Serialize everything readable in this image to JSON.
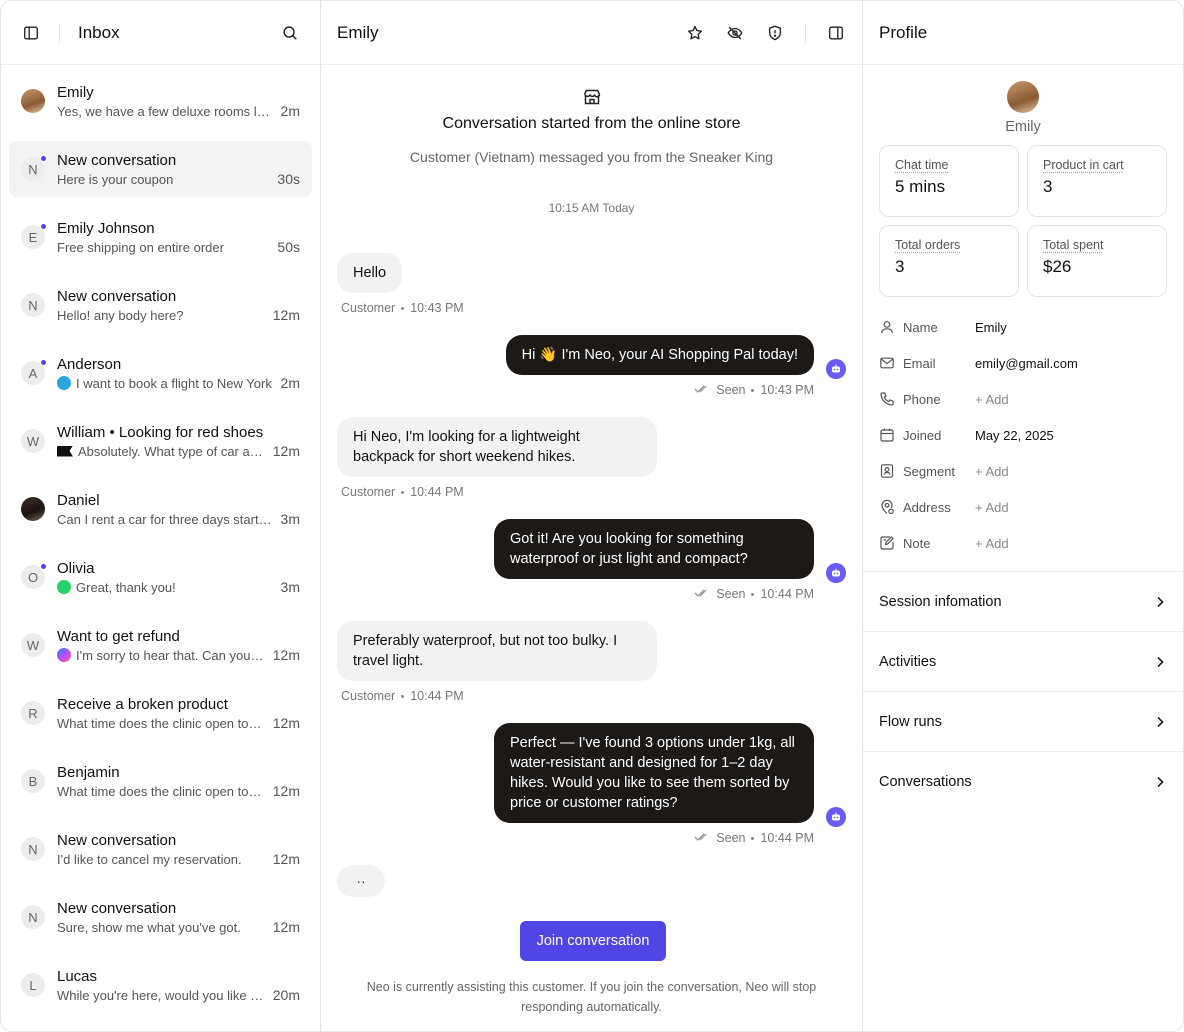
{
  "inbox": {
    "title": "Inbox",
    "conversations": [
      {
        "name": "Emily",
        "initial": "",
        "preview": "Yes, we have a few deluxe rooms left...",
        "time": "2m",
        "unread": false,
        "channel": "",
        "avatar": "photo"
      },
      {
        "name": "New conversation",
        "initial": "N",
        "preview": "Here is your coupon",
        "time": "30s",
        "unread": true,
        "channel": "",
        "avatar": "initial"
      },
      {
        "name": "Emily Johnson",
        "initial": "E",
        "preview": "Free shipping on entire order",
        "time": "50s",
        "unread": true,
        "channel": "",
        "avatar": "initial"
      },
      {
        "name": "New conversation",
        "initial": "N",
        "preview": "Hello! any body here?",
        "time": "12m",
        "unread": false,
        "channel": "",
        "avatar": "initial"
      },
      {
        "name": "Anderson",
        "initial": "A",
        "preview": "I want to book a flight to New York",
        "time": "2m",
        "unread": true,
        "channel": "telegram-icon",
        "avatar": "initial"
      },
      {
        "name": "William • Looking for red shoes",
        "initial": "W",
        "preview": "Absolutely. What type of car are you looking for?",
        "time": "12m",
        "unread": false,
        "channel": "flag-icon",
        "avatar": "initial"
      },
      {
        "name": "Daniel",
        "initial": "",
        "preview": "Can I rent a car for three days starting tomorrow?",
        "time": "3m",
        "unread": false,
        "channel": "",
        "avatar": "photo-dark"
      },
      {
        "name": "Olivia",
        "initial": "O",
        "preview": "Great, thank you!",
        "time": "3m",
        "unread": true,
        "channel": "whatsapp-icon",
        "avatar": "initial"
      },
      {
        "name": "Want to get refund",
        "initial": "W",
        "preview": "I'm sorry to hear that. Can you please share your order ID?",
        "time": "12m",
        "unread": false,
        "channel": "messenger-icon",
        "avatar": "initial"
      },
      {
        "name": "Receive a broken product",
        "initial": "R",
        "preview": "What time does the clinic open tomorrow?",
        "time": "12m",
        "unread": false,
        "channel": "",
        "avatar": "initial"
      },
      {
        "name": "Benjamin",
        "initial": "B",
        "preview": "What time does the clinic open tomorrow?",
        "time": "12m",
        "unread": false,
        "channel": "",
        "avatar": "initial"
      },
      {
        "name": "New conversation",
        "initial": "N",
        "preview": "I'd like to cancel my reservation.",
        "time": "12m",
        "unread": false,
        "channel": "",
        "avatar": "initial"
      },
      {
        "name": "New conversation",
        "initial": "N",
        "preview": "Sure, show me what you've got.",
        "time": "12m",
        "unread": false,
        "channel": "",
        "avatar": "initial"
      },
      {
        "name": "Lucas",
        "initial": "L",
        "preview": "While you're here, would you like to see more?",
        "time": "20m",
        "unread": false,
        "channel": "",
        "avatar": "initial"
      }
    ]
  },
  "chat": {
    "title": "Emily",
    "started_title": "Conversation started from the online store",
    "started_sub": "Customer (Vietnam) messaged you from the Sneaker King",
    "stamp": "10:15 AM Today",
    "messages": [
      {
        "dir": "in",
        "text": "Hello",
        "sender": "Customer",
        "time": "10:43 PM"
      },
      {
        "dir": "out",
        "text": "Hi 👋 I'm Neo, your AI Shopping Pal today!",
        "status": "Seen",
        "time": "10:43 PM"
      },
      {
        "dir": "in",
        "text": "Hi Neo, I'm looking for a lightweight backpack for short weekend hikes.",
        "sender": "Customer",
        "time": "10:44 PM"
      },
      {
        "dir": "out",
        "text": "Got it! Are you looking for something waterproof or just light and compact?",
        "status": "Seen",
        "time": "10:44 PM"
      },
      {
        "dir": "in",
        "text": "Preferably waterproof, but not too bulky. I travel light.",
        "sender": "Customer",
        "time": "10:44 PM"
      },
      {
        "dir": "out",
        "text": "Perfect — I've found 3 options under 1kg, all water-resistant and designed for 1–2 day hikes. Would you like to see them sorted by price or customer ratings?",
        "status": "Seen",
        "time": "10:44 PM"
      }
    ],
    "typing": "··",
    "join_label": "Join conversation",
    "join_note": "Neo is currently assisting this customer. If you join the conversation, Neo will stop responding automatically."
  },
  "profile": {
    "title": "Profile",
    "name": "Emily",
    "stats": [
      {
        "label": "Chat time",
        "value": "5 mins"
      },
      {
        "label": "Product in cart",
        "value": "3"
      },
      {
        "label": "Total orders",
        "value": "3"
      },
      {
        "label": "Total spent",
        "value": "$26"
      }
    ],
    "fields": [
      {
        "icon": "user-icon",
        "label": "Name",
        "value": "Emily",
        "muted": false
      },
      {
        "icon": "mail-icon",
        "label": "Email",
        "value": "emily@gmail.com",
        "muted": false
      },
      {
        "icon": "phone-icon",
        "label": "Phone",
        "value": "+ Add",
        "muted": true
      },
      {
        "icon": "calendar-icon",
        "label": "Joined",
        "value": "May 22, 2025",
        "muted": false
      },
      {
        "icon": "segment-icon",
        "label": "Segment",
        "value": "+ Add",
        "muted": true
      },
      {
        "icon": "location-icon",
        "label": "Address",
        "value": "+ Add",
        "muted": true
      },
      {
        "icon": "note-icon",
        "label": "Note",
        "value": "+ Add",
        "muted": true
      }
    ],
    "sections": [
      "Session infomation",
      "Activities",
      "Flow runs",
      "Conversations"
    ]
  },
  "colors": {
    "accent": "#4f46e5",
    "bubble_out": "#1c1917",
    "bubble_in": "#f2f2f2",
    "bot": "#6a5bf5"
  }
}
